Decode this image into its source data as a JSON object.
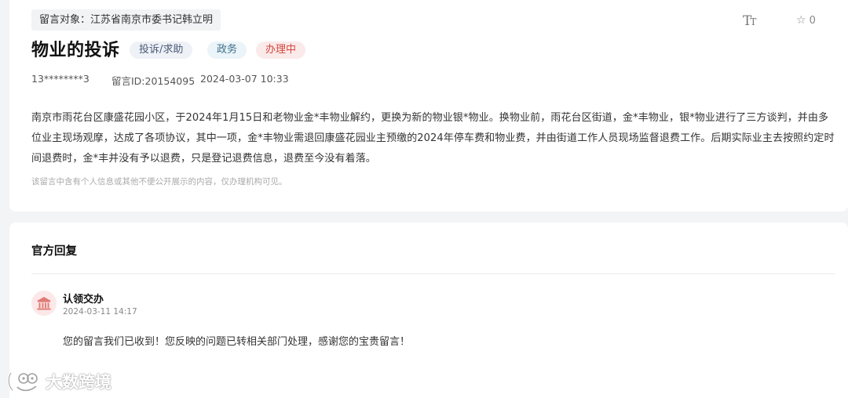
{
  "message": {
    "target_label": "留言对象：江苏省南京市委书记韩立明",
    "font_size_icon": "text-size-icon",
    "favorite_icon": "star-icon",
    "favorite_count": "0",
    "title": "物业的投诉",
    "tags": {
      "category": "投诉/求助",
      "government": "政务",
      "status": "办理中"
    },
    "colors": {
      "status_red": "#d6453d",
      "category_bg": "#eef1f6",
      "gov_bg": "#eaf4f9",
      "status_bg": "#fbeaea"
    },
    "user": "13********3",
    "message_id": "留言ID:20154095",
    "timestamp": "2024-03-07 10:33",
    "content": "南京市雨花台区康盛花园小区，于2024年1月15日和老物业金*丰物业解约，更换为新的物业银*物业。换物业前，雨花台区街道，金*丰物业，银*物业进行了三方谈判，并由多位业主现场观摩，达成了各项协议，其中一项，金*丰物业需退回康盛花园业主预缴的2024年停车费和物业费，并由街道工作人员现场监督退费工作。后期实际业主去按照约定时间退费时，金*丰并没有予以退费，只是登记退费信息，退费至今没有着落。",
    "privacy_notice": "该留言中含有个人信息或其他不便公开展示的内容，仅办理机构可见。"
  },
  "reply": {
    "heading": "官方回复",
    "department_icon": "government-building-icon",
    "department_name": "认领交办",
    "timestamp": "2024-03-11 14:17",
    "text": "您的留言我们已收到！您反映的问题已转相关部门处理，感谢您的宝贵留言！"
  },
  "watermark": {
    "text": "大数跨境",
    "logo_icon": "cartoon-logo-icon"
  }
}
